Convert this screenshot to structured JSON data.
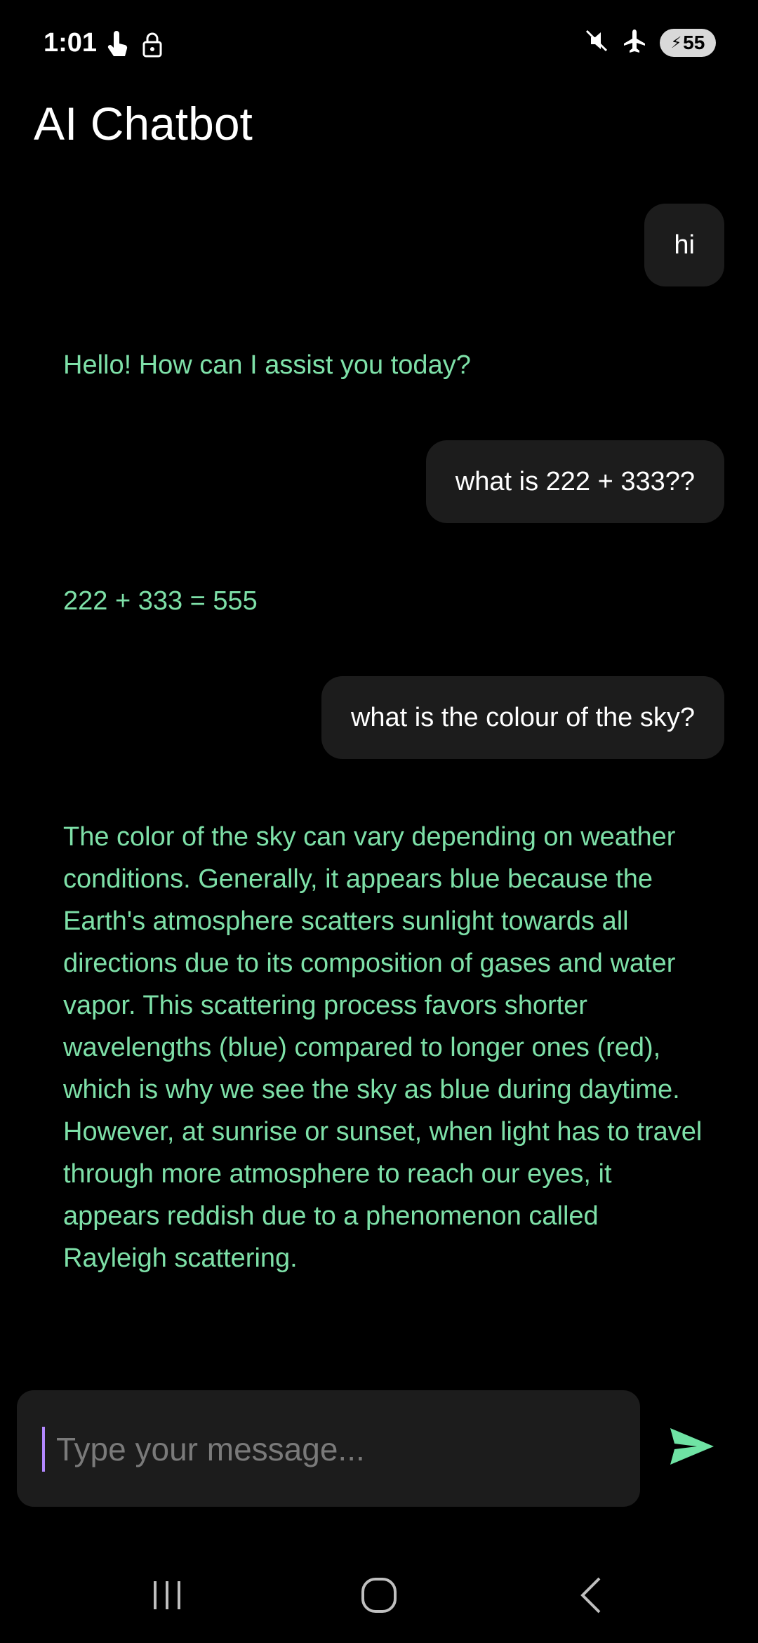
{
  "status_bar": {
    "time": "1:01",
    "battery_level": "55",
    "left_icons": [
      "touch-icon",
      "lock-icon"
    ],
    "right_icons": [
      "mute-icon",
      "airplane-icon",
      "battery-charging-icon"
    ]
  },
  "app": {
    "title": "AI Chatbot"
  },
  "messages": [
    {
      "role": "user",
      "text": "hi"
    },
    {
      "role": "bot",
      "text": "Hello! How can I assist you today?"
    },
    {
      "role": "user",
      "text": "what is 222 + 333??"
    },
    {
      "role": "bot",
      "text": "222 + 333 = 555"
    },
    {
      "role": "user",
      "text": "what is the colour of the sky?"
    },
    {
      "role": "bot",
      "text": "The color of the sky can vary depending on weather conditions. Generally, it appears blue because the Earth's atmosphere scatters sunlight towards all directions due to its composition of gases and water vapor. This scattering process favors shorter wavelengths (blue) compared to longer ones (red), which is why we see the sky as blue during daytime. However, at sunrise or sunset, when light has to travel through more atmosphere to reach our eyes, it appears reddish due to a phenomenon called Rayleigh scattering."
    }
  ],
  "input": {
    "value": "",
    "placeholder": "Type your message..."
  },
  "colors": {
    "background": "#000000",
    "user_bubble": "#1c1c1c",
    "bot_text": "#7ee0a8",
    "accent": "#6fe3a4",
    "caret": "#b388ff"
  },
  "nav": {
    "buttons": [
      "recent-apps-icon",
      "home-icon",
      "back-icon"
    ]
  }
}
